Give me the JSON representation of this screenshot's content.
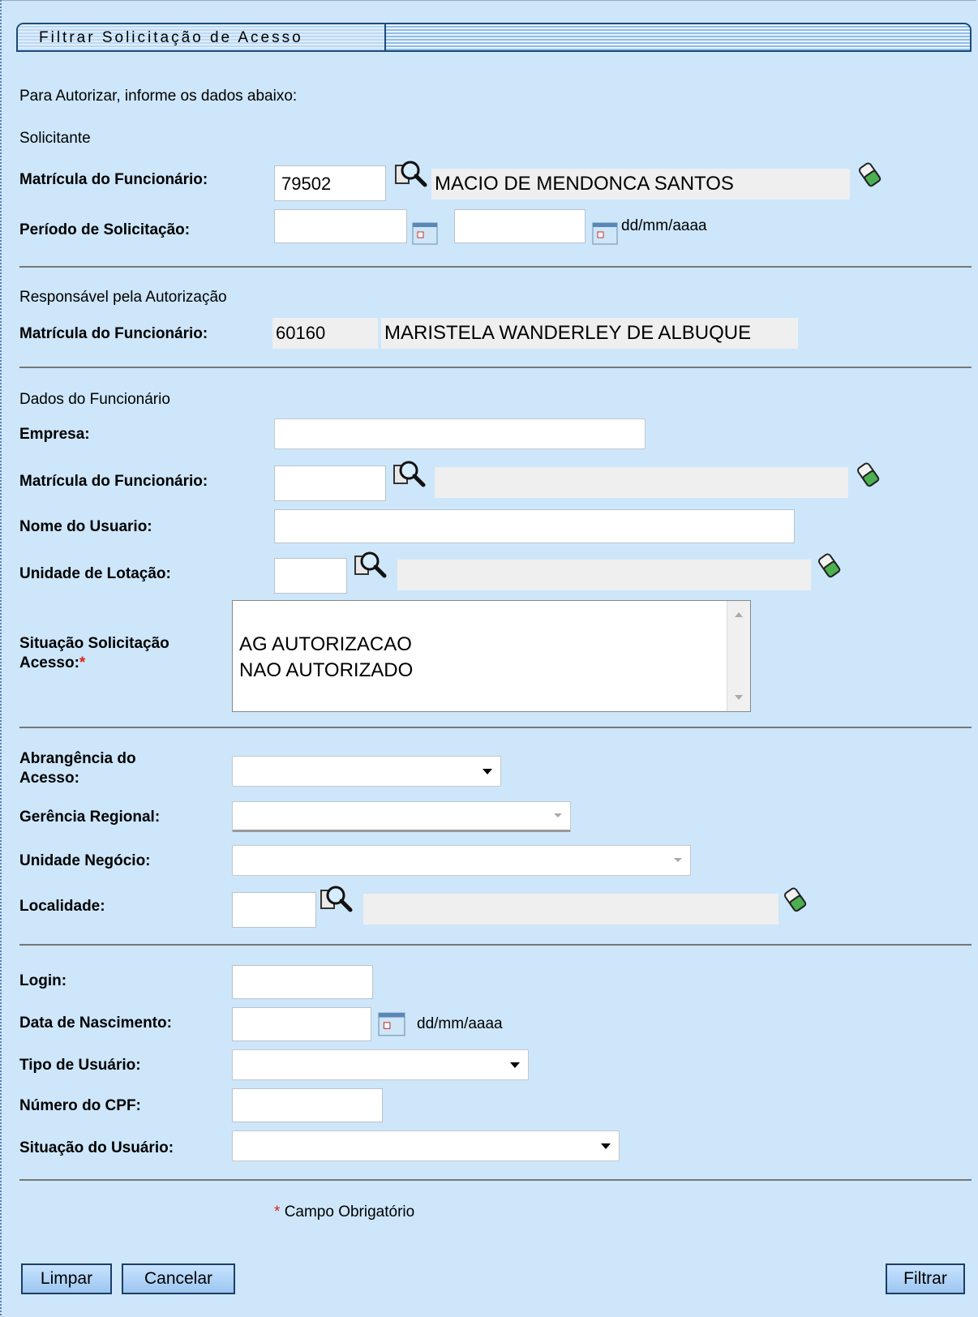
{
  "title": "Filtrar Solicitação de Acesso",
  "intro": "Para Autorizar, informe os dados abaixo:",
  "solicitante": {
    "heading": "Solicitante",
    "matricula_label": "Matrícula do Funcionário:",
    "matricula_value": "79502",
    "matricula_name": "MACIO DE MENDONCA SANTOS",
    "periodo_label": "Período de Solicitação:",
    "periodo_start": "",
    "periodo_end": "",
    "date_hint": "dd/mm/aaaa"
  },
  "responsavel": {
    "heading": "Responsável pela Autorização",
    "matricula_label": "Matrícula do Funcionário:",
    "matricula_value": "60160",
    "matricula_name": "MARISTELA WANDERLEY DE ALBUQUE"
  },
  "funcionario": {
    "heading": "Dados do Funcionário",
    "empresa_label": "Empresa:",
    "empresa_value": "",
    "matricula_label": "Matrícula do Funcionário:",
    "matricula_value": "",
    "matricula_name": "",
    "nome_label": "Nome do Usuario:",
    "nome_value": "",
    "unidade_label": "Unidade de Lotação:",
    "unidade_value": "",
    "unidade_name": "",
    "situacao_label_line1": "Situação Solicitação",
    "situacao_label_line2": "Acesso:",
    "required_mark": "*",
    "situacao_options": [
      "AG AUTORIZACAO",
      "NAO AUTORIZADO"
    ]
  },
  "abrangencia": {
    "abrangencia_label_line1": "Abrangência do",
    "abrangencia_label_line2": "Acesso:",
    "gerencia_label": "Gerência Regional:",
    "unidade_negocio_label": "Unidade Negócio:",
    "localidade_label": "Localidade:",
    "localidade_value": "",
    "localidade_name": ""
  },
  "usuario": {
    "login_label": "Login:",
    "login_value": "",
    "nascimento_label": "Data de Nascimento:",
    "nascimento_value": "",
    "date_hint": "dd/mm/aaaa",
    "tipo_label": "Tipo de Usuário:",
    "cpf_label": "Número do CPF:",
    "cpf_value": "",
    "situacao_label": "Situação do Usuário:"
  },
  "footer": {
    "required_mark": "*",
    "required_note": "Campo Obrigatório",
    "limpar": "Limpar",
    "cancelar": "Cancelar",
    "filtrar": "Filtrar"
  },
  "colors": {
    "background": "#cde6fa",
    "required": "#e0201a",
    "border": "#1e4a7a"
  }
}
